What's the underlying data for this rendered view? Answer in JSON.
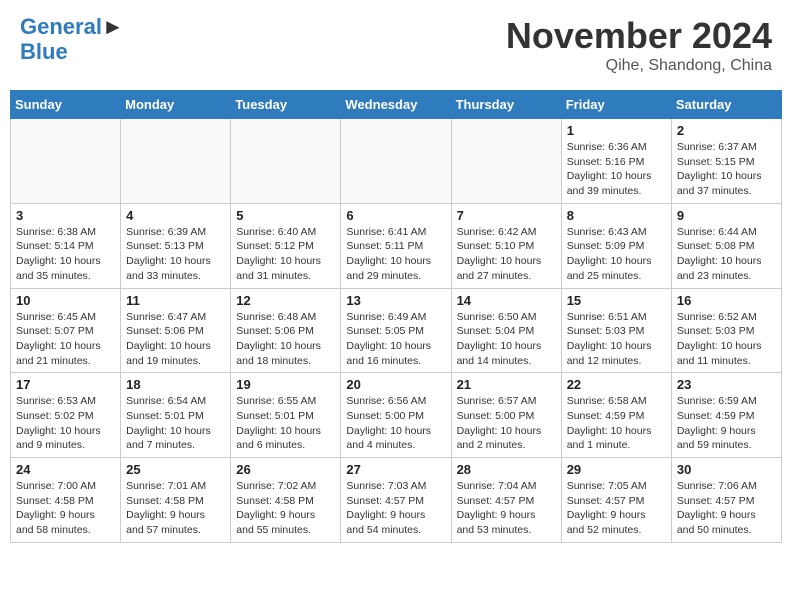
{
  "header": {
    "logo_line1": "General",
    "logo_line2": "Blue",
    "month": "November 2024",
    "location": "Qihe, Shandong, China"
  },
  "weekdays": [
    "Sunday",
    "Monday",
    "Tuesday",
    "Wednesday",
    "Thursday",
    "Friday",
    "Saturday"
  ],
  "weeks": [
    [
      {
        "day": "",
        "info": ""
      },
      {
        "day": "",
        "info": ""
      },
      {
        "day": "",
        "info": ""
      },
      {
        "day": "",
        "info": ""
      },
      {
        "day": "",
        "info": ""
      },
      {
        "day": "1",
        "info": "Sunrise: 6:36 AM\nSunset: 5:16 PM\nDaylight: 10 hours and 39 minutes."
      },
      {
        "day": "2",
        "info": "Sunrise: 6:37 AM\nSunset: 5:15 PM\nDaylight: 10 hours and 37 minutes."
      }
    ],
    [
      {
        "day": "3",
        "info": "Sunrise: 6:38 AM\nSunset: 5:14 PM\nDaylight: 10 hours and 35 minutes."
      },
      {
        "day": "4",
        "info": "Sunrise: 6:39 AM\nSunset: 5:13 PM\nDaylight: 10 hours and 33 minutes."
      },
      {
        "day": "5",
        "info": "Sunrise: 6:40 AM\nSunset: 5:12 PM\nDaylight: 10 hours and 31 minutes."
      },
      {
        "day": "6",
        "info": "Sunrise: 6:41 AM\nSunset: 5:11 PM\nDaylight: 10 hours and 29 minutes."
      },
      {
        "day": "7",
        "info": "Sunrise: 6:42 AM\nSunset: 5:10 PM\nDaylight: 10 hours and 27 minutes."
      },
      {
        "day": "8",
        "info": "Sunrise: 6:43 AM\nSunset: 5:09 PM\nDaylight: 10 hours and 25 minutes."
      },
      {
        "day": "9",
        "info": "Sunrise: 6:44 AM\nSunset: 5:08 PM\nDaylight: 10 hours and 23 minutes."
      }
    ],
    [
      {
        "day": "10",
        "info": "Sunrise: 6:45 AM\nSunset: 5:07 PM\nDaylight: 10 hours and 21 minutes."
      },
      {
        "day": "11",
        "info": "Sunrise: 6:47 AM\nSunset: 5:06 PM\nDaylight: 10 hours and 19 minutes."
      },
      {
        "day": "12",
        "info": "Sunrise: 6:48 AM\nSunset: 5:06 PM\nDaylight: 10 hours and 18 minutes."
      },
      {
        "day": "13",
        "info": "Sunrise: 6:49 AM\nSunset: 5:05 PM\nDaylight: 10 hours and 16 minutes."
      },
      {
        "day": "14",
        "info": "Sunrise: 6:50 AM\nSunset: 5:04 PM\nDaylight: 10 hours and 14 minutes."
      },
      {
        "day": "15",
        "info": "Sunrise: 6:51 AM\nSunset: 5:03 PM\nDaylight: 10 hours and 12 minutes."
      },
      {
        "day": "16",
        "info": "Sunrise: 6:52 AM\nSunset: 5:03 PM\nDaylight: 10 hours and 11 minutes."
      }
    ],
    [
      {
        "day": "17",
        "info": "Sunrise: 6:53 AM\nSunset: 5:02 PM\nDaylight: 10 hours and 9 minutes."
      },
      {
        "day": "18",
        "info": "Sunrise: 6:54 AM\nSunset: 5:01 PM\nDaylight: 10 hours and 7 minutes."
      },
      {
        "day": "19",
        "info": "Sunrise: 6:55 AM\nSunset: 5:01 PM\nDaylight: 10 hours and 6 minutes."
      },
      {
        "day": "20",
        "info": "Sunrise: 6:56 AM\nSunset: 5:00 PM\nDaylight: 10 hours and 4 minutes."
      },
      {
        "day": "21",
        "info": "Sunrise: 6:57 AM\nSunset: 5:00 PM\nDaylight: 10 hours and 2 minutes."
      },
      {
        "day": "22",
        "info": "Sunrise: 6:58 AM\nSunset: 4:59 PM\nDaylight: 10 hours and 1 minute."
      },
      {
        "day": "23",
        "info": "Sunrise: 6:59 AM\nSunset: 4:59 PM\nDaylight: 9 hours and 59 minutes."
      }
    ],
    [
      {
        "day": "24",
        "info": "Sunrise: 7:00 AM\nSunset: 4:58 PM\nDaylight: 9 hours and 58 minutes."
      },
      {
        "day": "25",
        "info": "Sunrise: 7:01 AM\nSunset: 4:58 PM\nDaylight: 9 hours and 57 minutes."
      },
      {
        "day": "26",
        "info": "Sunrise: 7:02 AM\nSunset: 4:58 PM\nDaylight: 9 hours and 55 minutes."
      },
      {
        "day": "27",
        "info": "Sunrise: 7:03 AM\nSunset: 4:57 PM\nDaylight: 9 hours and 54 minutes."
      },
      {
        "day": "28",
        "info": "Sunrise: 7:04 AM\nSunset: 4:57 PM\nDaylight: 9 hours and 53 minutes."
      },
      {
        "day": "29",
        "info": "Sunrise: 7:05 AM\nSunset: 4:57 PM\nDaylight: 9 hours and 52 minutes."
      },
      {
        "day": "30",
        "info": "Sunrise: 7:06 AM\nSunset: 4:57 PM\nDaylight: 9 hours and 50 minutes."
      }
    ]
  ]
}
